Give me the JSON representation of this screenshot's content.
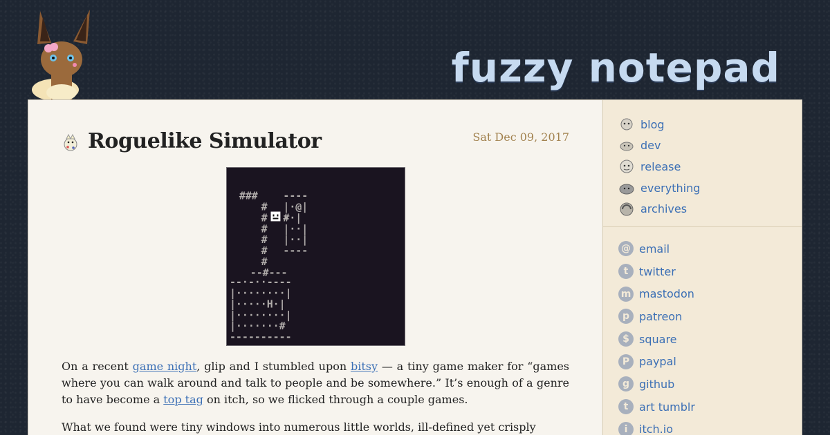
{
  "header": {
    "site_title": "fuzzy notepad"
  },
  "post": {
    "title": "Roguelike Simulator",
    "date": "Sat Dec 09, 2017",
    "paragraphs": [
      {
        "pre": "On a recent ",
        "link1": "game night",
        "mid1": ", glip and I stumbled upon ",
        "link2": "bitsy",
        "mid2": " — a tiny game maker for “games where you can walk around and talk to people and be somewhere.” It’s enough of a genre to have become a ",
        "link3": "top tag",
        "post": " on itch, so we flicked through a couple games."
      },
      {
        "text": "What we found were tiny windows into numerous little worlds, ill-defined yet crisply"
      }
    ]
  },
  "sidebar": {
    "nav": [
      {
        "label": "blog",
        "icon": "pokemon-blog-icon"
      },
      {
        "label": "dev",
        "icon": "pokemon-dev-icon"
      },
      {
        "label": "release",
        "icon": "pokemon-release-icon"
      },
      {
        "label": "everything",
        "icon": "pokemon-everything-icon"
      },
      {
        "label": "archives",
        "icon": "pokemon-archives-icon"
      }
    ],
    "links": [
      {
        "label": "email",
        "glyph": "@"
      },
      {
        "label": "twitter",
        "glyph": "t"
      },
      {
        "label": "mastodon",
        "glyph": "m"
      },
      {
        "label": "patreon",
        "glyph": "p"
      },
      {
        "label": "square",
        "glyph": "$"
      },
      {
        "label": "paypal",
        "glyph": "P"
      },
      {
        "label": "github",
        "glyph": "g"
      },
      {
        "label": "art tumblr",
        "glyph": "t"
      },
      {
        "label": "itch.io",
        "glyph": "i"
      }
    ]
  },
  "colors": {
    "link": "#3b6fb5",
    "date": "#a2824f",
    "title": "#c6daf0",
    "background": "#1e2632"
  }
}
